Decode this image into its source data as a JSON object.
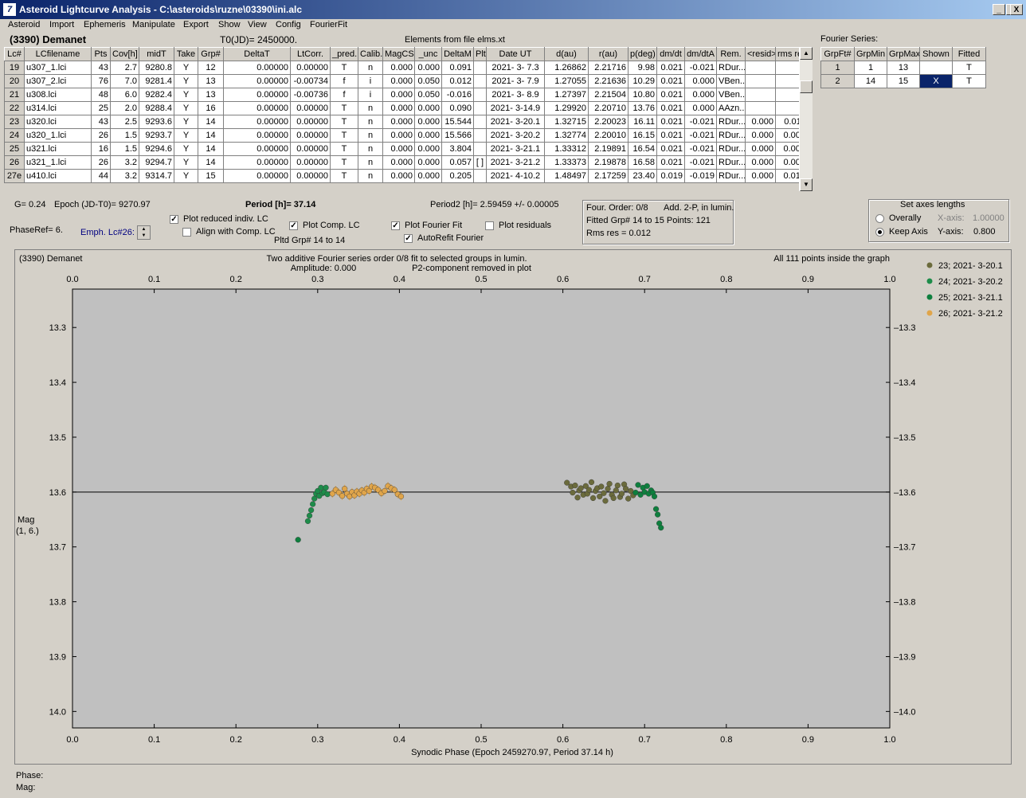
{
  "window": {
    "title": "Asteroid Lightcurve Analysis - C:\\asteroids\\ruzne\\03390\\ini.alc",
    "app_icon_text": "7",
    "minimize_glyph": "_",
    "maximize_glyph": "□",
    "close_glyph": "X"
  },
  "menu": [
    "Asteroid",
    "Import",
    "Ephemeris",
    "Manipulate",
    "Export",
    "Show",
    "View",
    "Config",
    "FourierFit"
  ],
  "header": {
    "asteroid": "(3390) Demanet",
    "t0": "T0(JD)= 2450000.",
    "elements": "Elements from file elms.xt"
  },
  "lc_table": {
    "columns": [
      "Lc#",
      "LCfilename",
      "Pts",
      "Cov[h]",
      "midT",
      "Take",
      "Grp#",
      "DeltaT",
      "LtCorr.",
      "_pred.",
      "Calib.",
      "MagCS",
      "_unc",
      "DeltaM",
      "Plt",
      "Date UT",
      "d(au)",
      "r(au)",
      "p(deg)",
      "dm/dt",
      "dm/dtA",
      "Rem.",
      "<resid>",
      "rms res"
    ],
    "rows": [
      [
        "19",
        "u307_1.lci",
        "43",
        "2.7",
        "9280.8",
        "Y",
        "12",
        "0.00000",
        "0.00000",
        "T",
        "n",
        "0.000",
        "0.000",
        "0.091",
        "",
        "2021- 3- 7.3",
        "1.26862",
        "2.21716",
        "9.98",
        "0.021",
        "-0.021",
        "RDur...",
        "",
        ""
      ],
      [
        "20",
        "u307_2.lci",
        "76",
        "7.0",
        "9281.4",
        "Y",
        "13",
        "0.00000",
        "-0.00734",
        "f",
        "i",
        "0.000",
        "0.050",
        "0.012",
        "",
        "2021- 3- 7.9",
        "1.27055",
        "2.21636",
        "10.29",
        "0.021",
        "0.000",
        "VBen...",
        "",
        ""
      ],
      [
        "21",
        "u308.lci",
        "48",
        "6.0",
        "9282.4",
        "Y",
        "13",
        "0.00000",
        "-0.00736",
        "f",
        "i",
        "0.000",
        "0.050",
        "-0.016",
        "",
        "2021- 3- 8.9",
        "1.27397",
        "2.21504",
        "10.80",
        "0.021",
        "0.000",
        "VBen...",
        "",
        ""
      ],
      [
        "22",
        "u314.lci",
        "25",
        "2.0",
        "9288.4",
        "Y",
        "16",
        "0.00000",
        "0.00000",
        "T",
        "n",
        "0.000",
        "0.000",
        "0.090",
        "",
        "2021- 3-14.9",
        "1.29920",
        "2.20710",
        "13.76",
        "0.021",
        "0.000",
        "AAzn...",
        "",
        ""
      ],
      [
        "23",
        "u320.lci",
        "43",
        "2.5",
        "9293.6",
        "Y",
        "14",
        "0.00000",
        "0.00000",
        "T",
        "n",
        "0.000",
        "0.000",
        "15.544",
        "",
        "2021- 3-20.1",
        "1.32715",
        "2.20023",
        "16.11",
        "0.021",
        "-0.021",
        "RDur...",
        "0.000",
        "0.011"
      ],
      [
        "24",
        "u320_1.lci",
        "26",
        "1.5",
        "9293.7",
        "Y",
        "14",
        "0.00000",
        "0.00000",
        "T",
        "n",
        "0.000",
        "0.000",
        "15.566",
        "",
        "2021- 3-20.2",
        "1.32774",
        "2.20010",
        "16.15",
        "0.021",
        "-0.021",
        "RDur...",
        "0.000",
        "0.008"
      ],
      [
        "25",
        "u321.lci",
        "16",
        "1.5",
        "9294.6",
        "Y",
        "14",
        "0.00000",
        "0.00000",
        "T",
        "n",
        "0.000",
        "0.000",
        "3.804",
        "",
        "2021- 3-21.1",
        "1.33312",
        "2.19891",
        "16.54",
        "0.021",
        "-0.021",
        "RDur...",
        "0.000",
        "0.007"
      ],
      [
        "26",
        "u321_1.lci",
        "26",
        "3.2",
        "9294.7",
        "Y",
        "14",
        "0.00000",
        "0.00000",
        "T",
        "n",
        "0.000",
        "0.000",
        "0.057",
        "[ ]",
        "2021- 3-21.2",
        "1.33373",
        "2.19878",
        "16.58",
        "0.021",
        "-0.021",
        "RDur...",
        "0.000",
        "0.009"
      ],
      [
        "27e",
        "u410.lci",
        "44",
        "3.2",
        "9314.7",
        "Y",
        "15",
        "0.00000",
        "0.00000",
        "T",
        "n",
        "0.000",
        "0.000",
        "0.205",
        "",
        "2021- 4-10.2",
        "1.48497",
        "2.17259",
        "23.40",
        "0.019",
        "-0.019",
        "RDur...",
        "0.000",
        "0.015"
      ]
    ]
  },
  "fourier_series": {
    "label": "Fourier Series:",
    "columns": [
      "GrpFt#",
      "GrpMin",
      "GrpMax",
      "Shown",
      "Fitted"
    ],
    "rows": [
      [
        "1",
        "1",
        "13",
        "",
        "T"
      ],
      [
        "2",
        "14",
        "15",
        "X",
        "T"
      ]
    ]
  },
  "info": {
    "g": "G= 0.24",
    "epoch": "Epoch (JD-T0)= 9270.97",
    "period": "Period [h]= 37.14",
    "period2": "Period2 [h]= 2.59459 +/- 0.00005",
    "phase_ref": "PhaseRef= 6.",
    "emph": "Emph. Lc#26:",
    "pltd_grp": "Pltd Grp#  14 to   14"
  },
  "checkboxes": {
    "plot_reduced": {
      "label": "Plot reduced indiv. LC",
      "checked": true
    },
    "align_comp": {
      "label": "Align with Comp. LC",
      "checked": false
    },
    "plot_comp": {
      "label": "Plot Comp. LC",
      "checked": true
    },
    "plot_fourier": {
      "label": "Plot Fourier Fit",
      "checked": true
    },
    "autorefit": {
      "label": "AutoRefit Fourier",
      "checked": true
    },
    "plot_resid": {
      "label": "Plot residuals",
      "checked": false
    }
  },
  "fourier_info": {
    "line1a": "Four. Order:  0/8",
    "line1b": "Add. 2-P, in lumin.",
    "line2": "Fitted Grp# 14 to 15 Points: 121",
    "line3": "Rms res      = 0.012"
  },
  "axes_box": {
    "title": "Set axes lengths",
    "overall": "Overally",
    "keep": "Keep Axis",
    "xaxis_label": "X-axis:",
    "xaxis_value": "1.00000",
    "yaxis_label": "Y-axis:",
    "yaxis_value": "0.800"
  },
  "plot": {
    "left_title": "(3390) Demanet",
    "center_title1": "Two additive Fourier series order 0/8 fit to selected groups in lumin.",
    "center_title2": "Amplitude: 0.000",
    "center_title3": "P2-component removed in plot",
    "right_title": "All 111 points inside the graph",
    "ylabel": "Mag",
    "ylabel2": "(1, 6.)",
    "xlabel": "Synodic Phase (Epoch 2459270.97, Period 37.14 h)"
  },
  "status": {
    "phase": "Phase:",
    "mag": "Mag:"
  },
  "colors": {
    "g23": "#6b6b3c",
    "g24": "#1e8c4a",
    "g25": "#0e7f3e",
    "g26": "#e0a54a",
    "plot_bg": "#c0c0c0"
  },
  "chart_data": {
    "type": "scatter",
    "xlim": [
      0.0,
      1.0
    ],
    "ylim": [
      14.03,
      13.23
    ],
    "xticks": [
      "0.0",
      "0.1",
      "0.2",
      "0.3",
      "0.4",
      "0.5",
      "0.6",
      "0.7",
      "0.8",
      "0.9",
      "1.0"
    ],
    "yticks": [
      "13.3",
      "13.4",
      "13.5",
      "13.6",
      "13.7",
      "13.8",
      "13.9",
      "14.0"
    ],
    "fit_line_mag": 13.6,
    "series": [
      {
        "name": "23; 2021- 3-20.1",
        "color_key": "g23",
        "x": [
          0.605,
          0.61,
          0.612,
          0.615,
          0.618,
          0.62,
          0.622,
          0.625,
          0.628,
          0.63,
          0.632,
          0.635,
          0.637,
          0.64,
          0.642,
          0.645,
          0.647,
          0.65,
          0.652,
          0.655,
          0.657,
          0.66,
          0.662,
          0.665,
          0.667,
          0.67,
          0.672,
          0.675,
          0.677,
          0.68,
          0.683,
          0.686
        ],
        "y": [
          13.583,
          13.59,
          13.601,
          13.588,
          13.61,
          13.597,
          13.593,
          13.605,
          13.589,
          13.603,
          13.596,
          13.582,
          13.611,
          13.598,
          13.593,
          13.608,
          13.59,
          13.602,
          13.616,
          13.594,
          13.585,
          13.605,
          13.611,
          13.597,
          13.588,
          13.609,
          13.603,
          13.586,
          13.594,
          13.612,
          13.598,
          13.606
        ]
      },
      {
        "name": "24; 2021- 3-20.2",
        "color_key": "g24",
        "x": [
          0.288,
          0.29,
          0.292,
          0.294,
          0.296,
          0.298,
          0.3,
          0.302,
          0.304,
          0.306,
          0.308,
          0.31,
          0.312
        ],
        "y": [
          13.653,
          13.643,
          13.633,
          13.622,
          13.612,
          13.603,
          13.598,
          13.607,
          13.592,
          13.602,
          13.6,
          13.592,
          13.604
        ]
      },
      {
        "name": "25; 2021- 3-21.1",
        "color_key": "g25",
        "x": [
          0.276,
          0.689,
          0.692,
          0.695,
          0.698,
          0.7,
          0.703,
          0.705,
          0.708,
          0.71,
          0.712,
          0.714,
          0.716,
          0.718,
          0.72
        ],
        "y": [
          13.687,
          13.601,
          13.587,
          13.605,
          13.592,
          13.6,
          13.589,
          13.603,
          13.597,
          13.601,
          13.608,
          13.631,
          13.641,
          13.657,
          13.665
        ]
      },
      {
        "name": "26; 2021- 3-21.2",
        "color_key": "g26",
        "x": [
          0.318,
          0.322,
          0.326,
          0.33,
          0.333,
          0.336,
          0.339,
          0.342,
          0.345,
          0.348,
          0.351,
          0.354,
          0.357,
          0.36,
          0.363,
          0.366,
          0.37,
          0.374,
          0.378,
          0.382,
          0.386,
          0.39,
          0.394,
          0.398,
          0.402
        ],
        "y": [
          13.603,
          13.596,
          13.601,
          13.607,
          13.594,
          13.603,
          13.608,
          13.6,
          13.606,
          13.599,
          13.603,
          13.597,
          13.601,
          13.594,
          13.598,
          13.59,
          13.592,
          13.596,
          13.602,
          13.598,
          13.589,
          13.593,
          13.596,
          13.604,
          13.608
        ]
      }
    ]
  }
}
